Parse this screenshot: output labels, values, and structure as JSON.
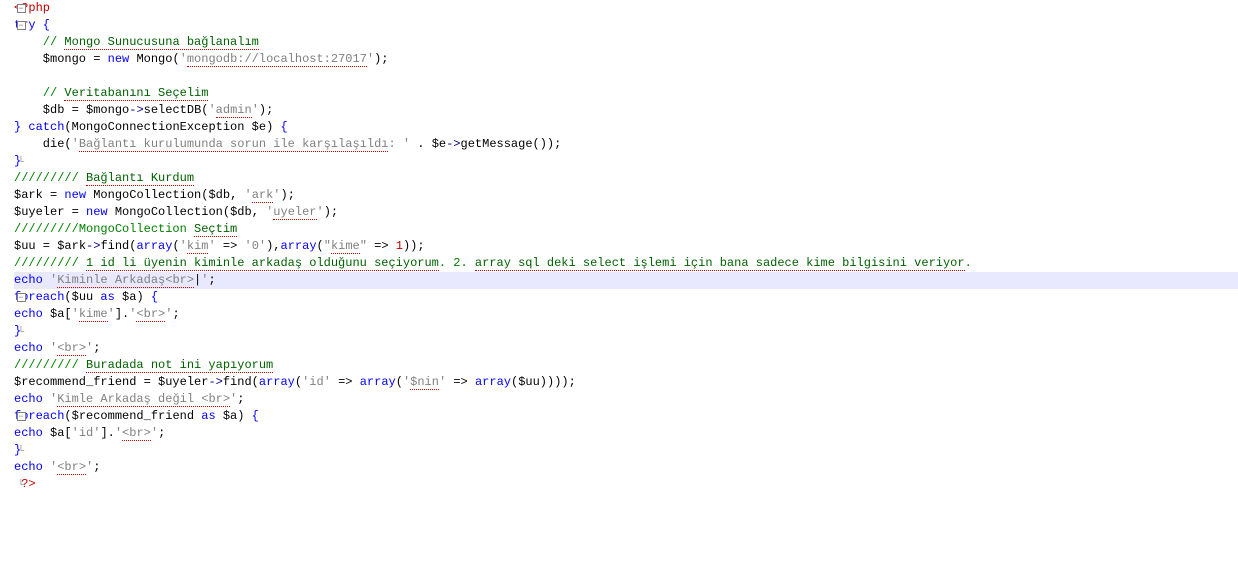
{
  "code": {
    "l1_php": "<?php",
    "l2_try": "try",
    "l2_brace": " {",
    "l3_comment": "// ",
    "l3_text": "Mongo Sunucusuna bağlanalım",
    "l4_var": "    $mongo",
    "l4_eq": " = ",
    "l4_new": "new",
    "l4_sp": " ",
    "l4_mongo": "Mongo",
    "l4_paren": "(",
    "l4_q1": "'",
    "l4_str": "mongodb://localhost:27017",
    "l4_q2": "'",
    "l4_end": ");",
    "l6_comment": "// ",
    "l6_text": "Veritabanını Seçelim",
    "l7_var": "    $db",
    "l7_eq": " = ",
    "l7_mongo": "$mongo",
    "l7_arrow": "->",
    "l7_fn": "selectDB",
    "l7_p1": "(",
    "l7_q1": "'",
    "l7_str": "admin",
    "l7_q2": "'",
    "l7_end": ");",
    "l8_brace": "} ",
    "l8_catch": "catch",
    "l8_p1": "(",
    "l8_cls": "MongoConnectionException ",
    "l8_e": "$e",
    "l8_p2": ")",
    "l8_brace2": " {",
    "l9_die": "    die",
    "l9_p1": "(",
    "l9_q1": "'",
    "l9_str": "Bağlantı kurulumunda sorun ile karşılaşıldı",
    "l9_str2": ": ",
    "l9_q2": "'",
    "l9_dot": " . ",
    "l9_e": "$e",
    "l9_arrow": "->",
    "l9_fn": "getMessage",
    "l9_end": "());",
    "l10_brace": "}",
    "l11_slash": "///////// ",
    "l11_text": "Bağlantı Kurdum",
    "l12_var": "$ark",
    "l12_eq": " = ",
    "l12_new": "new",
    "l12_sp": " ",
    "l12_cls": "MongoCollection",
    "l12_p1": "(",
    "l12_db": "$db",
    "l12_c": ", ",
    "l12_q1": "'",
    "l12_str": "ark",
    "l12_q2": "'",
    "l12_end": ");",
    "l13_var": "$uyeler",
    "l13_eq": " = ",
    "l13_new": "new",
    "l13_sp": " ",
    "l13_cls": "MongoCollection",
    "l13_p1": "(",
    "l13_db": "$db",
    "l13_c": ", ",
    "l13_q1": "'",
    "l13_str": "uyeler",
    "l13_q2": "'",
    "l13_end": ");",
    "l14_slash": "/////////",
    "l14_cls": "MongoCollection ",
    "l14_text": "Seçtim",
    "l15_var": "$uu",
    "l15_eq": " = ",
    "l15_ark": "$ark",
    "l15_arrow": "->",
    "l15_fn": "find",
    "l15_p1": "(",
    "l15_arr1": "array",
    "l15_p2": "(",
    "l15_q1": "'",
    "l15_kim": "kim",
    "l15_q2": "'",
    "l15_ar": " => ",
    "l15_q3": "'",
    "l15_zero": "0",
    "l15_q4": "'",
    "l15_p3": "),",
    "l15_arr2": "array",
    "l15_p4": "(",
    "l15_q5": "\"",
    "l15_kime": "kime",
    "l15_q6": "\"",
    "l15_ar2": " => ",
    "l15_one": "1",
    "l15_end": "));",
    "l16_slash": "///////// ",
    "l16_text": "1 id li üyenin kiminle arkadaş olduğunu seçiyorum",
    "l16_text2": ". 2. ",
    "l16_text3": "array sql deki select işlemi için bana sadece kime bilgisini veriyor",
    "l16_dot": ".",
    "l17_echo": "echo",
    "l17_sp": " ",
    "l17_q1": "'",
    "l17_str": "Kiminle Arkadaş<br>",
    "l17_q2": "'",
    "l17_cursor": "|",
    "l17_end": ";",
    "l18_foreach": "foreach",
    "l18_p1": "(",
    "l18_uu": "$uu",
    "l18_as": " as ",
    "l18_a": "$a",
    "l18_p2": ")",
    "l18_brace": " {",
    "l19_echo": "echo",
    "l19_sp": " ",
    "l19_a": "$a",
    "l19_b1": "[",
    "l19_q1": "'",
    "l19_kime": "kime",
    "l19_q2": "'",
    "l19_b2": "]",
    "l19_dot": ".",
    "l19_q3": "'",
    "l19_br": "<br>",
    "l19_q4": "'",
    "l19_end": ";",
    "l20_brace": "}",
    "l21_echo": "echo",
    "l21_sp": " ",
    "l21_q1": "'",
    "l21_br": "<br>",
    "l21_q2": "'",
    "l21_end": ";",
    "l22_slash": "///////// ",
    "l22_text": "Buradada not ini yapıyorum",
    "l23_var": "$recommend_friend",
    "l23_eq": " = ",
    "l23_uy": "$uyeler",
    "l23_arrow": "->",
    "l23_fn": "find",
    "l23_p1": "(",
    "l23_arr1": "array",
    "l23_p2": "(",
    "l23_q1": "'",
    "l23_id": "id",
    "l23_q2": "'",
    "l23_ar1": " => ",
    "l23_arr2": "array",
    "l23_p3": "(",
    "l23_q3": "'",
    "l23_nin": "$nin",
    "l23_q4": "'",
    "l23_ar2": " => ",
    "l23_arr3": "array",
    "l23_p4": "(",
    "l23_uu": "$uu",
    "l23_end": "))));",
    "l24_echo": "echo",
    "l24_sp": " ",
    "l24_q1": "'",
    "l24_str": "Kimle Arkadaş değil <br>",
    "l24_q2": "'",
    "l24_end": ";",
    "l25_foreach": "foreach",
    "l25_p1": "(",
    "l25_rf": "$recommend_friend",
    "l25_as": " as ",
    "l25_a": "$a",
    "l25_p2": ")",
    "l25_brace": " {",
    "l26_echo": "echo",
    "l26_sp": " ",
    "l26_a": "$a",
    "l26_b1": "[",
    "l26_q1": "'",
    "l26_id": "id",
    "l26_q2": "'",
    "l26_b2": "]",
    "l26_dot": ".",
    "l26_q3": "'",
    "l26_br": "<br>",
    "l26_q4": "'",
    "l26_end": ";",
    "l27_brace": "}",
    "l28_echo": "echo",
    "l28_sp": " ",
    "l28_q1": "'",
    "l28_br": "<br>",
    "l28_q2": "'",
    "l28_end": ";",
    "l29_php": " ?>"
  }
}
